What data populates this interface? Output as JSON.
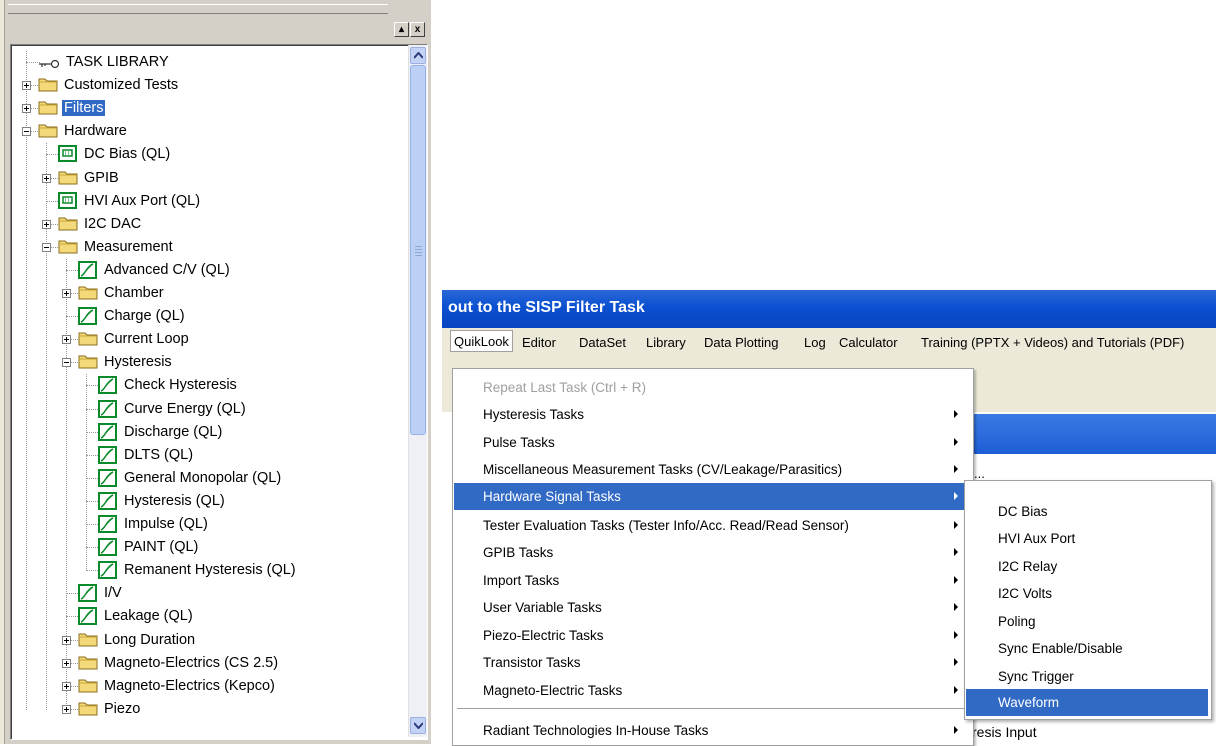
{
  "tree_panel": {
    "title_buttons": [
      "▴",
      "x"
    ],
    "items": [
      {
        "label": "TASK LIBRARY",
        "icon": "key-icon",
        "expander": "none"
      },
      {
        "label": "Customized Tests",
        "icon": "folder-icon",
        "expander": "plus"
      },
      {
        "label": "Filters",
        "icon": "folder-icon",
        "expander": "plus",
        "selected": true
      },
      {
        "label": "Hardware",
        "icon": "folder-icon",
        "expander": "minus"
      },
      {
        "label": "DC Bias (QL)",
        "icon": "hardware-task-icon",
        "expander": "none"
      },
      {
        "label": "GPIB",
        "icon": "folder-icon",
        "expander": "plus"
      },
      {
        "label": "HVI Aux Port (QL)",
        "icon": "hardware-task-icon",
        "expander": "none"
      },
      {
        "label": "I2C DAC",
        "icon": "folder-icon",
        "expander": "plus"
      },
      {
        "label": "Measurement",
        "icon": "folder-icon",
        "expander": "minus"
      },
      {
        "label": "Advanced C/V (QL)",
        "icon": "curve-task-icon",
        "expander": "none"
      },
      {
        "label": "Chamber",
        "icon": "folder-icon",
        "expander": "plus"
      },
      {
        "label": "Charge (QL)",
        "icon": "curve-task-icon",
        "expander": "none"
      },
      {
        "label": "Current Loop",
        "icon": "folder-icon",
        "expander": "plus"
      },
      {
        "label": "Hysteresis",
        "icon": "folder-icon",
        "expander": "minus"
      },
      {
        "label": "Check Hysteresis",
        "icon": "curve-task-icon",
        "expander": "none"
      },
      {
        "label": "Curve Energy (QL)",
        "icon": "curve-task-icon",
        "expander": "none"
      },
      {
        "label": "Discharge (QL)",
        "icon": "curve-task-icon",
        "expander": "none"
      },
      {
        "label": "DLTS (QL)",
        "icon": "curve-task-icon",
        "expander": "none"
      },
      {
        "label": "General Monopolar (QL)",
        "icon": "curve-task-icon",
        "expander": "none"
      },
      {
        "label": "Hysteresis (QL)",
        "icon": "curve-task-icon",
        "expander": "none"
      },
      {
        "label": "Impulse (QL)",
        "icon": "curve-task-icon",
        "expander": "none"
      },
      {
        "label": "PAINT (QL)",
        "icon": "curve-task-icon",
        "expander": "none"
      },
      {
        "label": "Remanent Hysteresis (QL)",
        "icon": "curve-task-icon",
        "expander": "none"
      },
      {
        "label": "I/V",
        "icon": "curve-task-icon",
        "expander": "none"
      },
      {
        "label": "Leakage (QL)",
        "icon": "curve-task-icon",
        "expander": "none"
      },
      {
        "label": "Long Duration",
        "icon": "folder-icon",
        "expander": "plus"
      },
      {
        "label": "Magneto-Electrics (CS 2.5)",
        "icon": "folder-icon",
        "expander": "plus"
      },
      {
        "label": "Magneto-Electrics (Kepco)",
        "icon": "folder-icon",
        "expander": "plus"
      },
      {
        "label": "Piezo",
        "icon": "folder-icon",
        "expander": "plus"
      }
    ]
  },
  "app": {
    "title": "out to the SISP Filter Task",
    "menubar": [
      {
        "label": "QuikLook",
        "open": true
      },
      {
        "label": "Editor"
      },
      {
        "label": "DataSet"
      },
      {
        "label": "Library"
      },
      {
        "label": "Data Plotting"
      },
      {
        "label": "Log"
      },
      {
        "label": "Calculator"
      },
      {
        "label": "Training (PPTX + Videos) and Tutorials (PDF)"
      }
    ],
    "background_fragments": [
      "...",
      "resis Input"
    ]
  },
  "quiklook_menu": {
    "items": [
      {
        "label": "Repeat Last Task (Ctrl + R)",
        "disabled": true,
        "submenu": false
      },
      {
        "label": "Hysteresis Tasks",
        "submenu": true
      },
      {
        "label": "Pulse Tasks",
        "submenu": true
      },
      {
        "label": "Miscellaneous Measurement Tasks (CV/Leakage/Parasitics)",
        "submenu": true
      },
      {
        "label": "Hardware Signal Tasks",
        "submenu": true,
        "highlighted": true
      },
      {
        "label": "Tester Evaluation Tasks (Tester Info/Acc. Read/Read Sensor)",
        "submenu": true
      },
      {
        "label": "GPIB Tasks",
        "submenu": true
      },
      {
        "label": "Import Tasks",
        "submenu": true
      },
      {
        "label": "User Variable Tasks",
        "submenu": true
      },
      {
        "label": "Piezo-Electric Tasks",
        "submenu": true
      },
      {
        "label": "Transistor Tasks",
        "submenu": true
      },
      {
        "label": "Magneto-Electric Tasks",
        "submenu": true
      },
      {
        "label": "Radiant Technologies In-House Tasks",
        "submenu": true,
        "after_separator": true
      }
    ]
  },
  "hardware_submenu": {
    "items": [
      {
        "label": "DC Bias"
      },
      {
        "label": "HVI Aux Port"
      },
      {
        "label": "I2C Relay"
      },
      {
        "label": "I2C Volts"
      },
      {
        "label": "Poling"
      },
      {
        "label": "Sync Enable/Disable"
      },
      {
        "label": "Sync Trigger"
      },
      {
        "label": "Waveform",
        "highlighted": true
      }
    ]
  },
  "colors": {
    "selection": "#316ac5",
    "title_bar": "#0a50d0",
    "menu_bar": "#ece9d8",
    "folder": "#f3d979",
    "task_icon_green": "#0a8a2a"
  }
}
